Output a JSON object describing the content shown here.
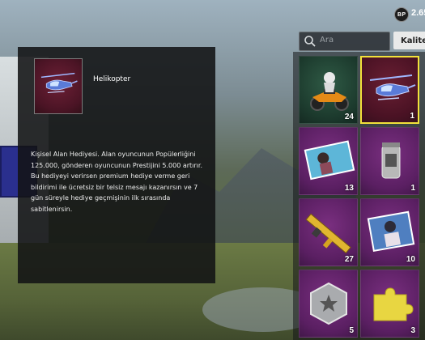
{
  "status": {
    "bp_label": "BP",
    "bp_value": "2.65"
  },
  "search": {
    "placeholder": "Ara"
  },
  "filter": {
    "quality_label": "Kalite"
  },
  "detail": {
    "name": "Helikopter",
    "description": "Kişisel Alan Hediyesi. Alan oyuncunun Popülerliğini 125.000, gönderen oyuncunun Prestijini 5.000 artırır. Bu hediyeyi verirsen premium hediye verme geri bildirimi ile ücretsiz bir telsiz mesajı kazanırsın ve 7 gün süreyle hediye geçmişinin ilk sırasında sabitlenirsin."
  },
  "inventory": {
    "items": [
      {
        "icon": "motorcycle-icon",
        "count": "24",
        "rarity_color": "#2f5a45"
      },
      {
        "icon": "helicopter-icon",
        "count": "1",
        "rarity_color": "#6a1f33",
        "selected": true
      },
      {
        "icon": "character-card-icon",
        "count": "13",
        "rarity_color": "#7a2f80"
      },
      {
        "icon": "canister-icon",
        "count": "1",
        "rarity_color": "#7a2f80"
      },
      {
        "icon": "golden-rifle-icon",
        "count": "27",
        "rarity_color": "#7a2f80"
      },
      {
        "icon": "portrait-card-icon",
        "count": "10",
        "rarity_color": "#7a2f80"
      },
      {
        "icon": "star-badge-icon",
        "count": "5",
        "rarity_color": "#7a2f80"
      },
      {
        "icon": "puzzle-piece-icon",
        "count": "3",
        "rarity_color": "#7a2f80"
      }
    ]
  },
  "colors": {
    "selected_border": "#f2e23a",
    "panel_bg": "#121314"
  }
}
